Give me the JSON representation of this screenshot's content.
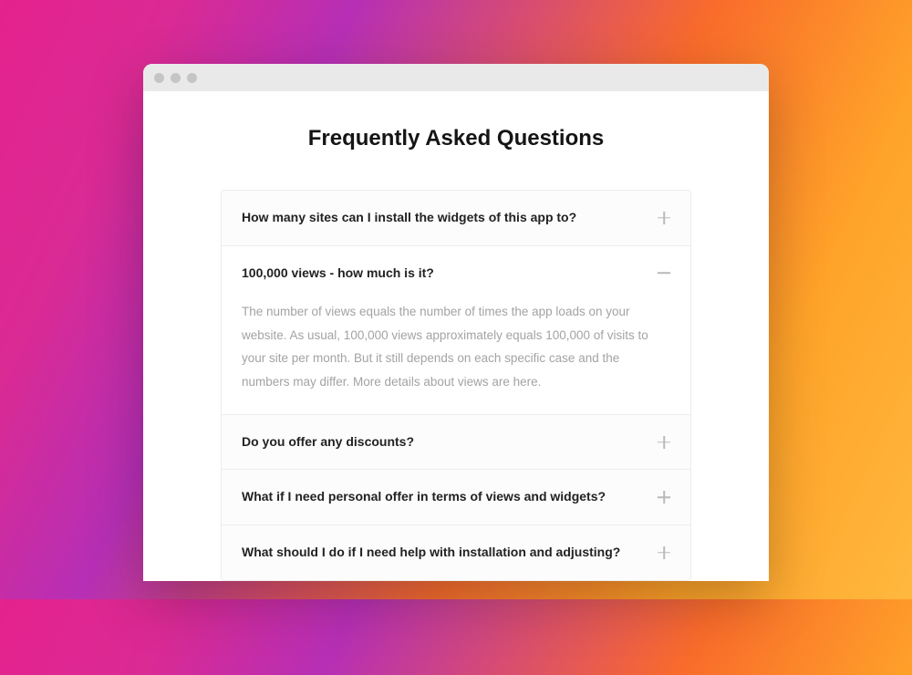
{
  "page": {
    "title": "Frequently Asked Questions"
  },
  "faq": {
    "items": [
      {
        "question": "How many sites can I install the widgets of this app to?",
        "answer": "",
        "expanded": false
      },
      {
        "question": "100,000 views - how much is it?",
        "answer": "The number of views equals the number of times the app loads on your website. As usual, 100,000 views approximately equals 100,000 of visits to your site per month. But it still depends on  each specific case and the numbers may differ. More details about views are here.",
        "expanded": true
      },
      {
        "question": "Do you offer any discounts?",
        "answer": "",
        "expanded": false
      },
      {
        "question": "What if I need personal offer in terms of views and widgets?",
        "answer": "",
        "expanded": false
      },
      {
        "question": "What should I do if I need help with installation and adjusting?",
        "answer": "",
        "expanded": false
      }
    ]
  }
}
